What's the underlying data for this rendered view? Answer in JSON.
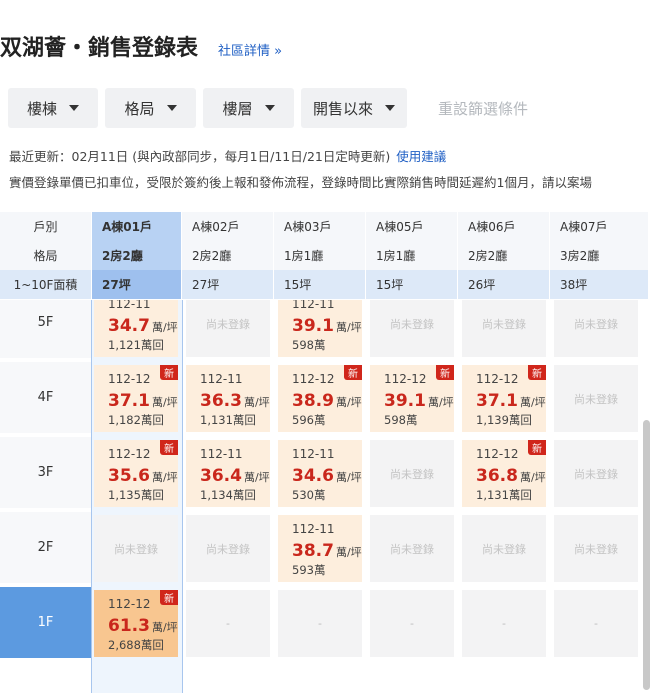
{
  "header": {
    "title": "双湖薈・銷售登錄表",
    "community_link": "社區詳情 »"
  },
  "filters": {
    "building": "樓棟",
    "layout": "格局",
    "floor": "樓層",
    "period": "開售以來",
    "reset": "重設篩選條件"
  },
  "update": {
    "text": "最近更新：02月11日 (與內政部同步，每月1日/11日/21日定時更新)",
    "help": "使用建議",
    "note": "實價登錄單價已扣車位，受限於簽約後上報和發佈流程，登錄時間比實際銷售時間延遲約1個月，請以案場"
  },
  "table": {
    "row_labels": {
      "unit": "戶別",
      "layout": "格局",
      "area": "1~10F面積"
    },
    "columns": [
      {
        "unit": "A棟01戶",
        "layout": "2房2廳",
        "area": "27坪",
        "selected": true
      },
      {
        "unit": "A棟02戶",
        "layout": "2房2廳",
        "area": "27坪",
        "selected": false
      },
      {
        "unit": "A棟03戶",
        "layout": "1房1廳",
        "area": "15坪",
        "selected": false
      },
      {
        "unit": "A棟05戶",
        "layout": "1房1廳",
        "area": "15坪",
        "selected": false
      },
      {
        "unit": "A棟06戶",
        "layout": "2房2廳",
        "area": "26坪",
        "selected": false
      },
      {
        "unit": "A棟07戶",
        "layout": "3房2廳",
        "area": "38坪",
        "selected": false
      }
    ],
    "price_unit": "萬/坪",
    "empty_label": "尚未登錄",
    "dash_label": "-",
    "new_badge": "新",
    "floors": [
      {
        "floor": "5F",
        "active": false,
        "units": [
          {
            "type": "sale",
            "date": "112-11",
            "price": "34.7",
            "total": "1,121萬回",
            "new": false
          },
          {
            "type": "empty"
          },
          {
            "type": "sale",
            "date": "112-11",
            "price": "39.1",
            "total": "598萬",
            "new": false
          },
          {
            "type": "empty"
          },
          {
            "type": "empty"
          },
          {
            "type": "empty"
          }
        ]
      },
      {
        "floor": "4F",
        "active": false,
        "units": [
          {
            "type": "sale",
            "date": "112-12",
            "price": "37.1",
            "total": "1,182萬回",
            "new": true
          },
          {
            "type": "sale",
            "date": "112-11",
            "price": "36.3",
            "total": "1,131萬回",
            "new": false
          },
          {
            "type": "sale",
            "date": "112-12",
            "price": "38.9",
            "total": "596萬",
            "new": true
          },
          {
            "type": "sale",
            "date": "112-12",
            "price": "39.1",
            "total": "598萬",
            "new": true
          },
          {
            "type": "sale",
            "date": "112-12",
            "price": "37.1",
            "total": "1,139萬回",
            "new": true
          },
          {
            "type": "empty"
          }
        ]
      },
      {
        "floor": "3F",
        "active": false,
        "units": [
          {
            "type": "sale",
            "date": "112-12",
            "price": "35.6",
            "total": "1,135萬回",
            "new": true
          },
          {
            "type": "sale",
            "date": "112-11",
            "price": "36.4",
            "total": "1,134萬回",
            "new": false
          },
          {
            "type": "sale",
            "date": "112-11",
            "price": "34.6",
            "total": "530萬",
            "new": false
          },
          {
            "type": "empty"
          },
          {
            "type": "sale",
            "date": "112-12",
            "price": "36.8",
            "total": "1,131萬回",
            "new": true
          },
          {
            "type": "empty"
          }
        ]
      },
      {
        "floor": "2F",
        "active": false,
        "units": [
          {
            "type": "empty"
          },
          {
            "type": "empty"
          },
          {
            "type": "sale",
            "date": "112-11",
            "price": "38.7",
            "total": "593萬",
            "new": false
          },
          {
            "type": "empty"
          },
          {
            "type": "empty"
          },
          {
            "type": "empty"
          }
        ]
      },
      {
        "floor": "1F",
        "active": true,
        "units": [
          {
            "type": "hot",
            "date": "112-12",
            "price": "61.3",
            "total": "2,688萬回",
            "new": true
          },
          {
            "type": "dash"
          },
          {
            "type": "dash"
          },
          {
            "type": "dash"
          },
          {
            "type": "dash"
          },
          {
            "type": "dash"
          }
        ]
      }
    ]
  }
}
